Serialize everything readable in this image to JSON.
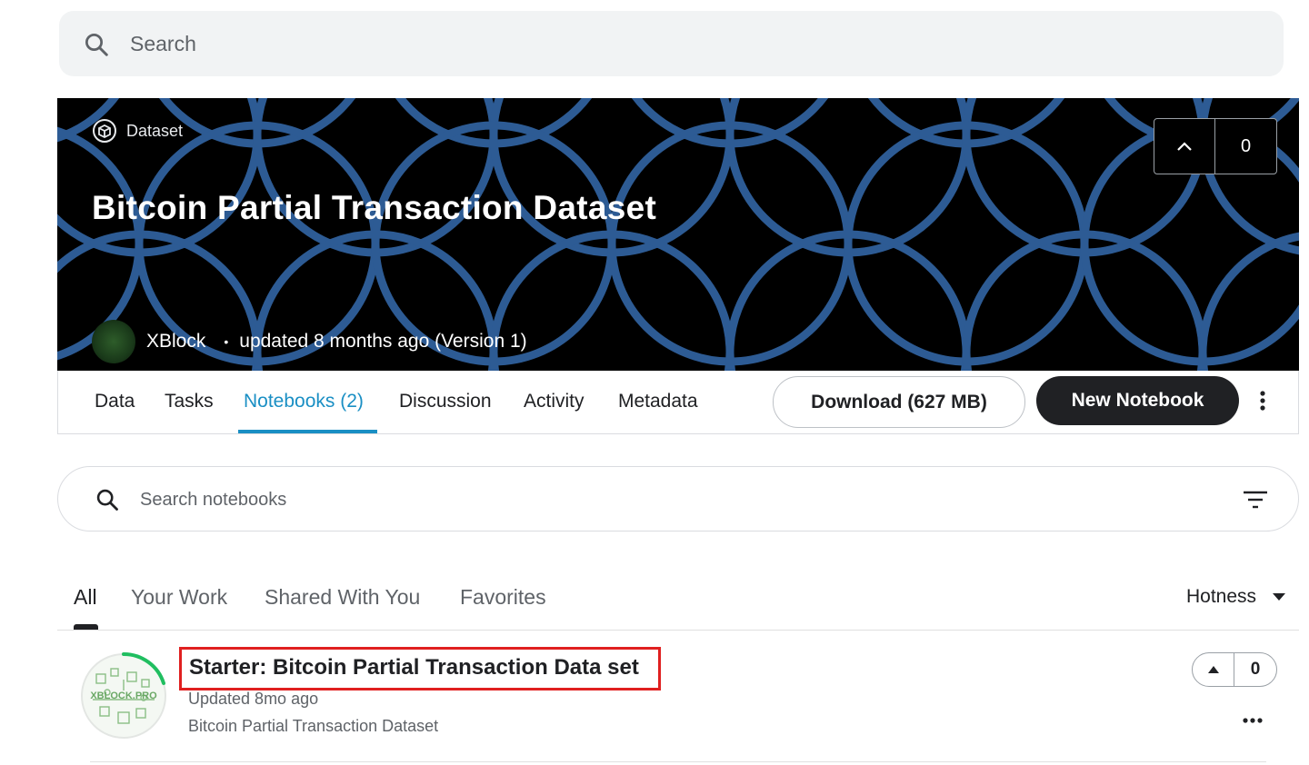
{
  "search": {
    "placeholder": "Search"
  },
  "dataset": {
    "badge": "Dataset",
    "title": "Bitcoin Partial Transaction Dataset",
    "votes": "0",
    "author": "XBlock",
    "separator": "•",
    "updated": "updated 8 months ago (Version 1)"
  },
  "tabs": [
    {
      "label": "Data"
    },
    {
      "label": "Tasks"
    },
    {
      "label": "Notebooks (2)"
    },
    {
      "label": "Discussion"
    },
    {
      "label": "Activity"
    },
    {
      "label": "Metadata"
    }
  ],
  "actions": {
    "download": "Download (627 MB)",
    "new_notebook": "New Notebook"
  },
  "notebook_search": {
    "placeholder": "Search notebooks"
  },
  "subtabs": [
    {
      "label": "All"
    },
    {
      "label": "Your Work"
    },
    {
      "label": "Shared With You"
    },
    {
      "label": "Favorites"
    }
  ],
  "sort": {
    "label": "Hotness"
  },
  "notebooks": [
    {
      "title": "Starter: Bitcoin Partial Transaction Data set",
      "updated": "Updated 8mo ago",
      "source": "Bitcoin Partial Transaction Dataset",
      "votes": "0",
      "thumb_text": "XBLOCK.PRO"
    }
  ],
  "colors": {
    "accent": "#1a8fc4",
    "banner_pattern": "#2d5b94",
    "highlight_border": "#e02020",
    "progress_ring": "#20be60"
  }
}
